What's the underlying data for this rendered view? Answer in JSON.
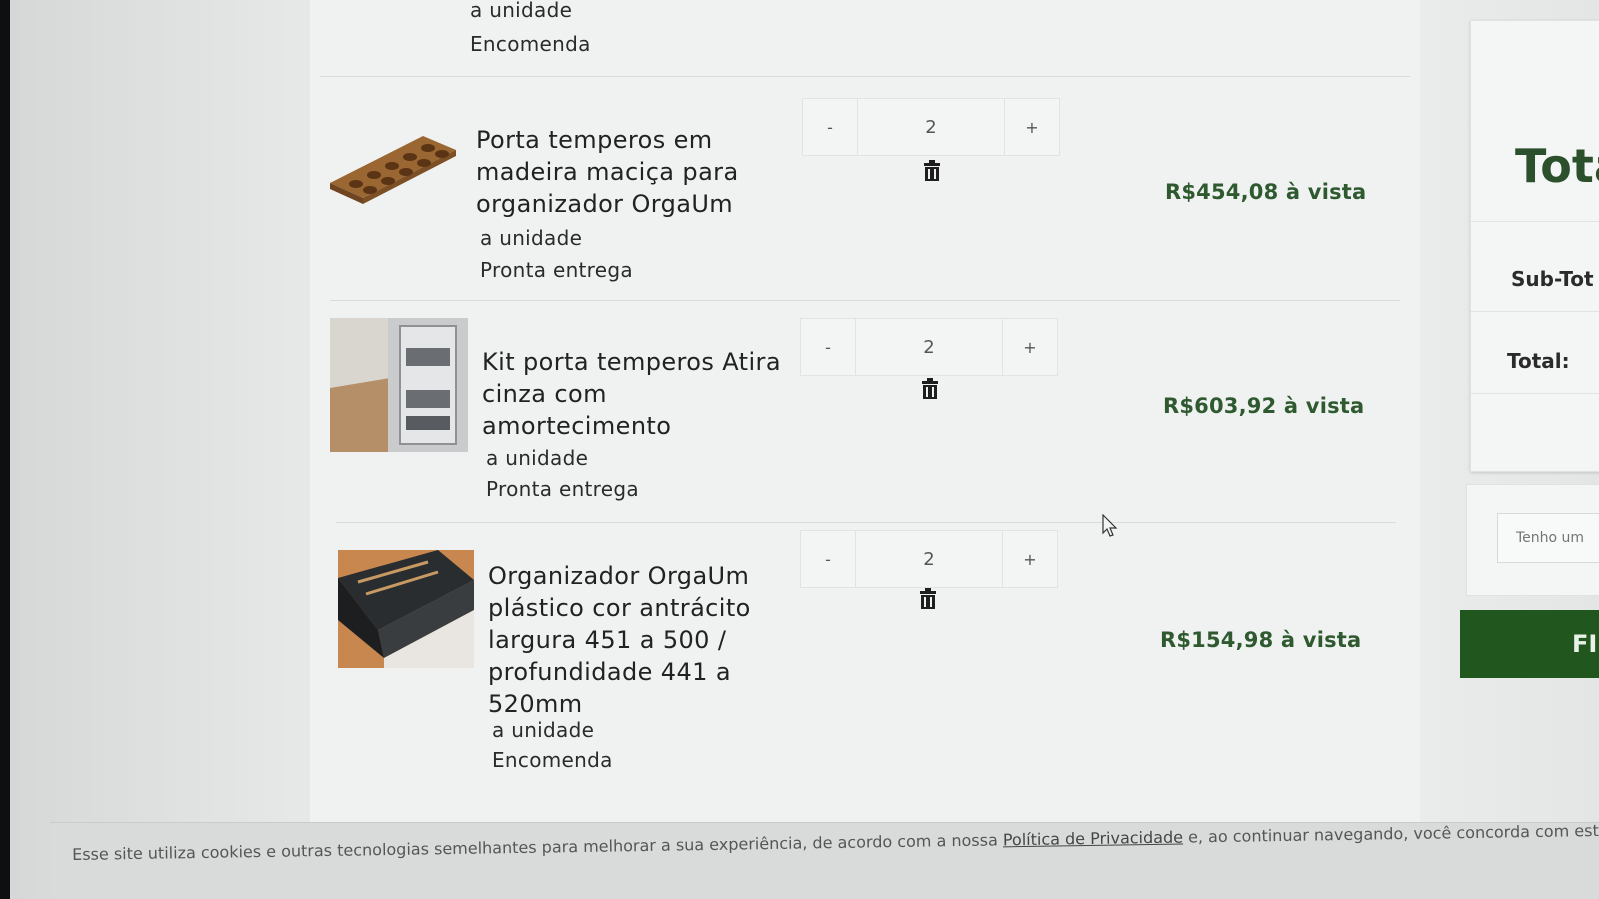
{
  "items": [
    {
      "unit_label": "a unidade",
      "availability": "Encomenda"
    },
    {
      "name_lines": [
        "Porta temperos em",
        "madeira maciça para",
        "organizador OrgaUm"
      ],
      "unit_label": "a unidade",
      "availability": "Pronta entrega",
      "quantity": "2",
      "price": "R$454,08 à vista",
      "thumb_icon": "wooden-spice-rack-image"
    },
    {
      "name_lines": [
        "Kit porta temperos Atira",
        "cinza com",
        "amortecimento"
      ],
      "unit_label": "a unidade",
      "availability": "Pronta entrega",
      "quantity": "2",
      "price": "R$603,92 à vista",
      "thumb_icon": "pull-out-spice-rack-image"
    },
    {
      "name_lines": [
        "Organizador OrgaUm",
        "plástico cor antrácito",
        "largura 451 a 500 /",
        "profundidade 441 a",
        "520mm"
      ],
      "unit_label": "a unidade",
      "availability": "Encomenda",
      "quantity": "2",
      "price": "R$154,98 à vista",
      "thumb_icon": "drawer-organizer-image"
    }
  ],
  "qty_controls": {
    "minus": "-",
    "plus": "+"
  },
  "summary": {
    "title": "Tota",
    "subtotal_label": "Sub-Tot",
    "total_label": "Total:"
  },
  "coupon": {
    "placeholder": "Tenho um"
  },
  "finish_button": "FI",
  "cookie": {
    "text_before": "Esse site utiliza cookies e outras tecnologias semelhantes para melhorar a sua experiência, de acordo com a nossa ",
    "link": "Política de Privacidade",
    "text_after": " e, ao continuar navegando, você concorda com estas"
  },
  "colors": {
    "price_green": "#2f5a2f",
    "button_green": "#22561f"
  }
}
